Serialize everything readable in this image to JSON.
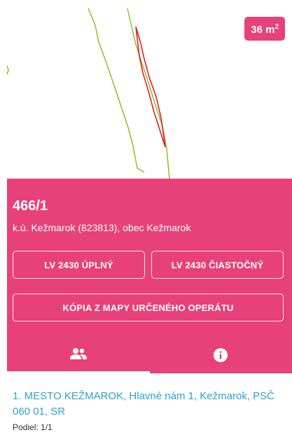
{
  "map": {
    "area_value": "36 m",
    "area_unit_sup": "2"
  },
  "parcel": {
    "number": "466/1",
    "location": "k.ú. Kežmarok (823813), obec Kežmarok"
  },
  "buttons": {
    "lv_full": "LV 2430 ÚPLNÝ",
    "lv_partial": "LV 2430 ČIASTOČNÝ",
    "map_copy": "KÓPIA Z MAPY URČENÉHO OPERÁTU"
  },
  "tabs": [
    {
      "icon": "people-icon",
      "active": true
    },
    {
      "icon": "info-icon",
      "active": false
    }
  ],
  "owners": [
    {
      "name": "1. MESTO KEŽMAROK, Hlavné nám 1, Kežmarok, PSČ 060 01, SR",
      "share": "Podiel: 1/1"
    }
  ],
  "colors": {
    "accent": "#e8417a",
    "link": "#2ba3cf",
    "parcel_line": "#8fbf2a",
    "highlight": "#e0202a"
  }
}
